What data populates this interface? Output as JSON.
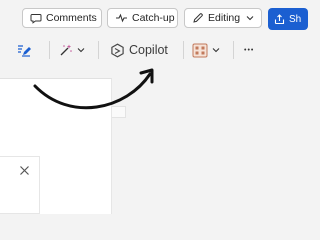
{
  "topbar": {
    "comments_label": "Comments",
    "catchup_label": "Catch-up",
    "editing_label": "Editing",
    "share_label": "Sh"
  },
  "ribbon": {
    "copilot_label": "Copilot",
    "more_label": "•••"
  },
  "icons": {
    "comments": "comment-icon",
    "catchup": "pulse-icon",
    "editing": "pencil-icon",
    "share": "share-icon",
    "editor": "editor-pen-icon",
    "designer": "magic-wand-icon",
    "copilot": "copilot-icon",
    "add_in": "grid-icon",
    "close": "close-icon"
  },
  "colors": {
    "accent": "#1b5fd1",
    "copilot": "#4a4a4a",
    "annotation_arrow": "#111111"
  }
}
